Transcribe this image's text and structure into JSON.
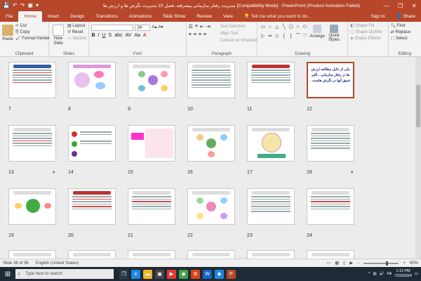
{
  "titlebar": {
    "title": "مدیریت رفتار سازمانی پیشرفته..فصل 10 مدیریت نگرش ها و ارزش ها [Compatibility Mode] - PowerPoint (Product Activation Failed)",
    "minimize": "—",
    "restore": "❐",
    "close": "✕"
  },
  "tabs": [
    "File",
    "Home",
    "Insert",
    "Design",
    "Transitions",
    "Animations",
    "Slide Show",
    "Review",
    "View"
  ],
  "active_tab": "Home",
  "tell_me": "Tell me what you want to do...",
  "sign_in": "Sign in",
  "share": "Share",
  "ribbon": {
    "clipboard": {
      "paste": "Paste",
      "cut": "Cut",
      "copy": "Copy",
      "format_painter": "Format Painter",
      "label": "Clipboard"
    },
    "slides": {
      "new_slide": "New Slide",
      "layout": "Layout",
      "reset": "Reset",
      "section": "Section",
      "label": "Slides"
    },
    "font": {
      "font_size": "24",
      "label": "Font"
    },
    "paragraph": {
      "text_direction": "Text Direction",
      "align_text": "Align Text",
      "smartart": "Convert to SmartArt",
      "label": "Paragraph"
    },
    "drawing": {
      "arrange": "Arrange",
      "quick_styles": "Quick Styles",
      "shape_fill": "Shape Fill",
      "shape_outline": "Shape Outline",
      "shape_effects": "Shape Effects",
      "label": "Drawing"
    },
    "editing": {
      "find": "Find",
      "replace": "Replace",
      "select": "Select",
      "label": "Editing"
    }
  },
  "slides": [
    {
      "num": "7",
      "star": ""
    },
    {
      "num": "8",
      "star": ""
    },
    {
      "num": "9",
      "star": ""
    },
    {
      "num": "10",
      "star": ""
    },
    {
      "num": "11",
      "star": ""
    },
    {
      "num": "12",
      "star": ""
    },
    {
      "num": "13",
      "star": "★"
    },
    {
      "num": "14",
      "star": ""
    },
    {
      "num": "15",
      "star": ""
    },
    {
      "num": "16",
      "star": ""
    },
    {
      "num": "17",
      "star": ""
    },
    {
      "num": "18",
      "star": "★"
    },
    {
      "num": "19",
      "star": ""
    },
    {
      "num": "20",
      "star": ""
    },
    {
      "num": "21",
      "star": ""
    },
    {
      "num": "22",
      "star": ""
    },
    {
      "num": "23",
      "star": ""
    },
    {
      "num": "24",
      "star": ""
    }
  ],
  "slide12_text": "یکی از دلایل مطالعه ارزش ها در رفتار سازمانی ، تأثیر عمیق آنها در نگرش هاست .",
  "statusbar": {
    "slide_info": "Slide 36 of 36",
    "language": "English (United States)",
    "zoom": "65%"
  },
  "taskbar": {
    "search_placeholder": "Type here to search",
    "time": "1:11 PM",
    "date": "7/23/2024",
    "lang": "FA"
  },
  "colors": {
    "accent": "#b7472a",
    "taskbar": "#1f2a36"
  }
}
